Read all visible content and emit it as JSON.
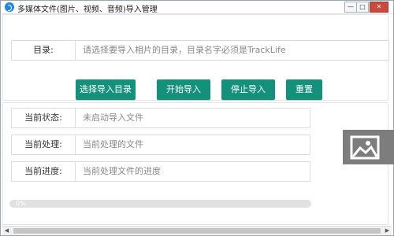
{
  "window": {
    "title": "多媒体文件(图片、视频、音频)导入管理",
    "controls": {
      "minimize": "—",
      "maximize": "□",
      "close": "✕"
    }
  },
  "directory": {
    "label": "目录:",
    "placeholder": "请选择要导入相片的目录，目录名字必须是TrackLife"
  },
  "buttons": {
    "select_dir": "选择导入目录",
    "start": "开始导入",
    "stop": "停止导入",
    "reset": "重置"
  },
  "status": {
    "state_label": "当前状态:",
    "state_value": "未启动导入文件",
    "processing_label": "当前处理:",
    "processing_value": "当前处理的文件",
    "progress_label": "当前进度:",
    "progress_value": "当前处理文件的进度"
  },
  "progress": {
    "text": "0%",
    "percent": 0
  },
  "colors": {
    "accent": "#14917b",
    "progress_fill": "#2da77f",
    "progress_track": "#e1e1e1",
    "close_button": "#c94a3d"
  },
  "icons": {
    "app": "app-logo-icon",
    "side": "image-placeholder-icon",
    "scroll_left": "arrow-left-icon",
    "scroll_right": "arrow-right-icon"
  }
}
